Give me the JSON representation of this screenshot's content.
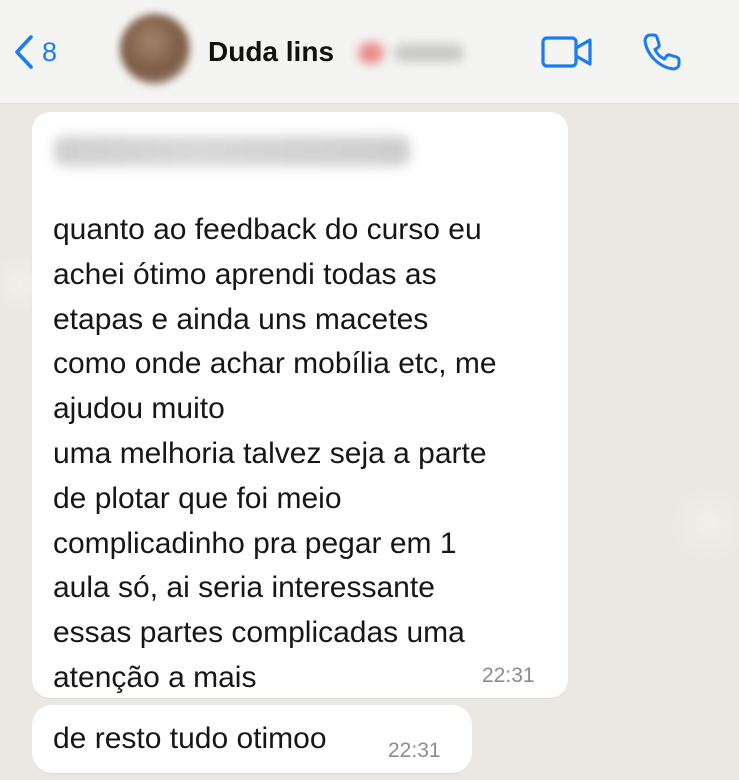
{
  "header": {
    "back_count": "8",
    "contact_name": "Duda lins"
  },
  "messages": [
    {
      "text": "quanto ao feedback do curso eu\nachei ótimo aprendi todas as\netapas e ainda uns macetes\ncomo onde achar mobília etc, me\najudou muito\numa melhoria talvez seja a parte\nde plotar que foi meio\ncomplicadinho pra pegar em 1\naula só, ai seria interessante\nessas partes complicadas uma\natenção a mais",
      "time": "22:31"
    },
    {
      "text": "de resto tudo otimoo",
      "time": "22:31"
    }
  ],
  "colors": {
    "accent": "#1a7cf3",
    "bubble": "#ffffff",
    "chat_background": "#ebe7e2",
    "header_background": "#f4f4f2",
    "timestamp": "#8c8c8c"
  },
  "icons": [
    "chevron-left-icon",
    "video-camera-icon",
    "phone-icon"
  ]
}
